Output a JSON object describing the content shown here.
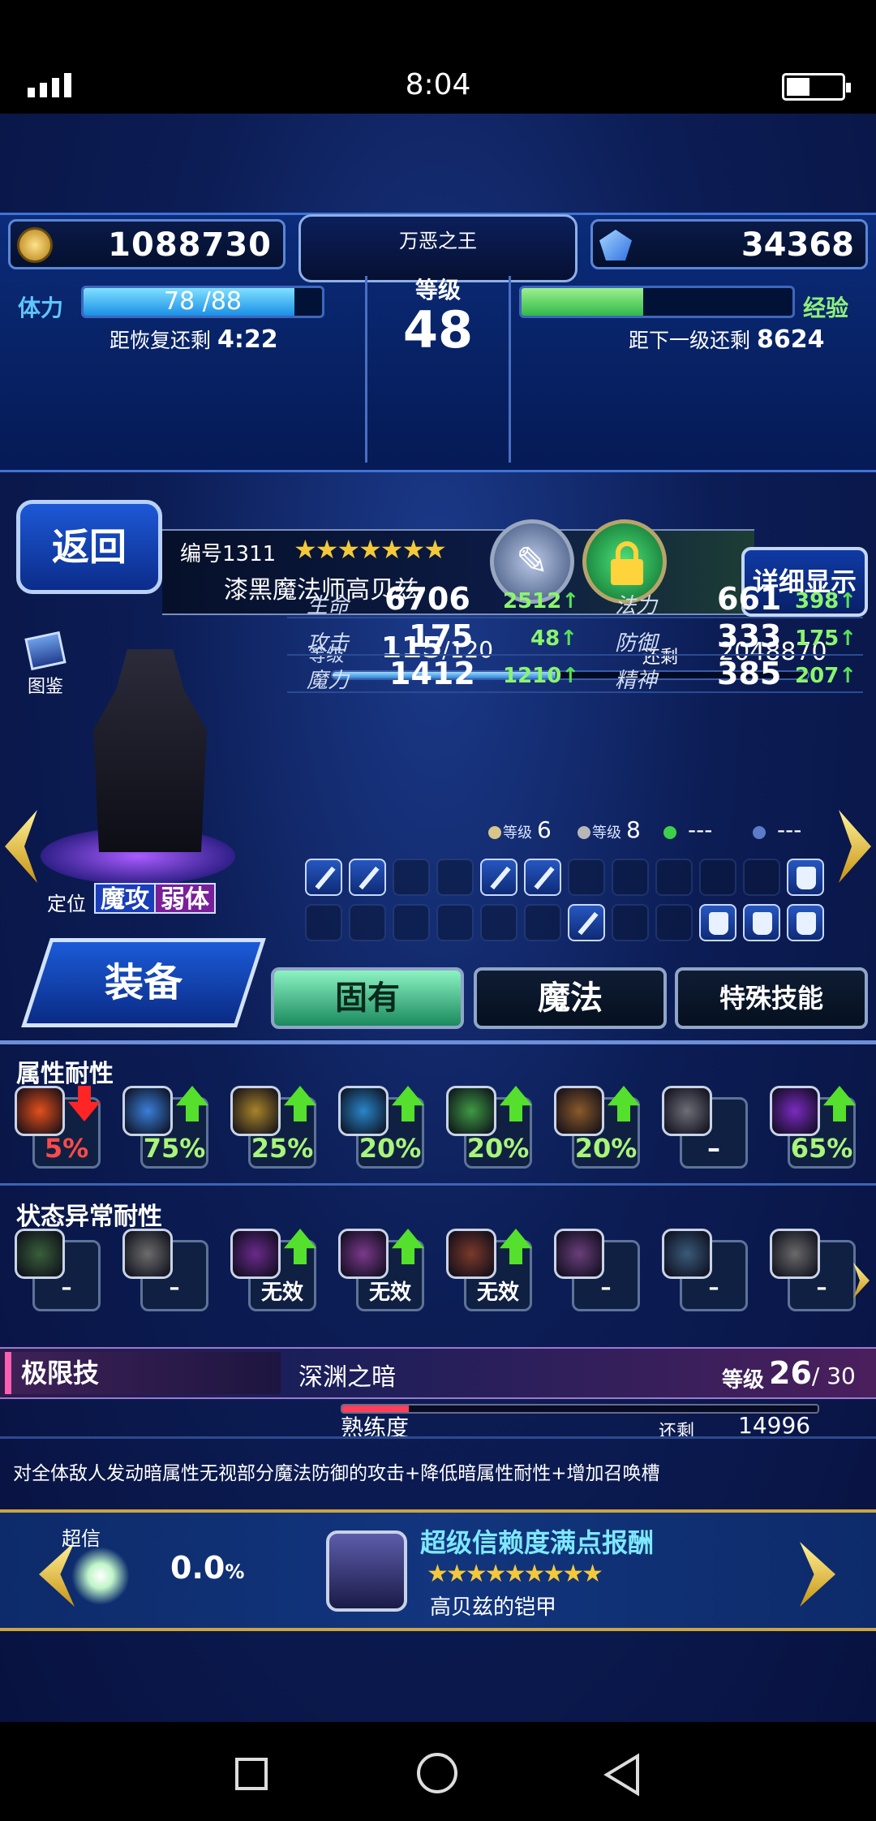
{
  "status_bar": {
    "time": "8:04"
  },
  "header": {
    "gil": "1088730",
    "gems": "34368",
    "title_name": "万恶之王",
    "level_label": "等级",
    "level": "48",
    "stamina_label": "体力",
    "stamina": "78 /88",
    "stamina_fraction": 0.886,
    "recover_label": "距恢复还剩",
    "recover_time": "4:22",
    "exp_label": "经验",
    "exp_fraction": 0.45,
    "next_label": "距下一级还剩",
    "next_exp": "8624"
  },
  "unit": {
    "back_label": "返回",
    "number": "编号1311",
    "rarity_stars": "★★★★★★★",
    "name": "漆黑魔法师高贝兹",
    "detail_label": "详细显示",
    "encyclopedia_label": "图鉴",
    "role_label": "定位",
    "roles": [
      "魔攻",
      "弱体"
    ],
    "level_label": "等级",
    "level": "115",
    "level_max": "/120",
    "remaining_label": "还剩",
    "remaining_exp": "2048870",
    "level_fraction": 0.47
  },
  "stats": [
    {
      "left_label": "生命",
      "left_value": "6706",
      "left_bonus": "2512",
      "right_label": "法力",
      "right_value": "661",
      "right_bonus": "398"
    },
    {
      "left_label": "攻击",
      "left_value": "175",
      "left_bonus": "48",
      "right_label": "防御",
      "right_value": "333",
      "right_bonus": "175"
    },
    {
      "left_label": "魔力",
      "left_value": "1412",
      "left_bonus": "1210",
      "right_label": "精神",
      "right_value": "385",
      "right_bonus": "207"
    }
  ],
  "orbs": [
    {
      "label": "等级",
      "value": "6",
      "color": "#d8c58a"
    },
    {
      "label": "等级",
      "value": "8",
      "color": "#b7b7b7"
    },
    {
      "label": "",
      "value": "---",
      "color": "#3fd04a"
    },
    {
      "label": "",
      "value": "---",
      "color": "#5b7cc8"
    }
  ],
  "tabs": {
    "equip": "装备",
    "innate": "固有",
    "magic": "魔法",
    "special": "特殊技能"
  },
  "resistance": {
    "element_title": "属性耐性",
    "elements": [
      {
        "name": "fire-icon",
        "value": "5%",
        "trend": "down",
        "color": "#e4501b"
      },
      {
        "name": "ice-icon",
        "value": "75%",
        "trend": "up",
        "color": "#3a7fd8"
      },
      {
        "name": "lightning-icon",
        "value": "25%",
        "trend": "up",
        "color": "#a8842a"
      },
      {
        "name": "water-icon",
        "value": "20%",
        "trend": "up",
        "color": "#2a86c8"
      },
      {
        "name": "wind-icon",
        "value": "20%",
        "trend": "up",
        "color": "#3f9a44"
      },
      {
        "name": "earth-icon",
        "value": "20%",
        "trend": "up",
        "color": "#8a5a2a"
      },
      {
        "name": "light-icon",
        "value": "–",
        "trend": "none",
        "color": "#6e6e78"
      },
      {
        "name": "dark-icon",
        "value": "65%",
        "trend": "up",
        "color": "#7b2bbf"
      }
    ],
    "status_title": "状态异常耐性",
    "statuses": [
      {
        "name": "poison-icon",
        "value": "–",
        "trend": "none",
        "color": "#3a5f3a"
      },
      {
        "name": "blind-icon",
        "value": "–",
        "trend": "none",
        "color": "#6d6d6d"
      },
      {
        "name": "sleep-icon",
        "value": "无效",
        "trend": "up",
        "color": "#6a2b8a"
      },
      {
        "name": "silence-icon",
        "value": "无效",
        "trend": "up",
        "color": "#7a3a8a"
      },
      {
        "name": "paralyze-icon",
        "value": "无效",
        "trend": "up",
        "color": "#7a3a2a"
      },
      {
        "name": "confuse-icon",
        "value": "–",
        "trend": "none",
        "color": "#6a3f7a"
      },
      {
        "name": "disease-icon",
        "value": "–",
        "trend": "none",
        "color": "#3a5a7a"
      },
      {
        "name": "petrify-icon",
        "value": "–",
        "trend": "none",
        "color": "#6a6a6a"
      }
    ]
  },
  "limit_burst": {
    "label": "极限技",
    "name": "深渊之暗",
    "level_label": "等级",
    "level": "26",
    "level_max": "/ 30",
    "proficiency_label": "熟练度",
    "proficiency_fraction": 0.14,
    "remaining_label": "还剩",
    "remaining": "14996",
    "description": "对全体敌人发动暗属性无视部分魔法防御的攻击+降低暗属性耐性+增加召唤槽"
  },
  "trust": {
    "label": "超信",
    "value": "0.0",
    "unit": "%",
    "reward_title": "超级信赖度满点报酬",
    "reward_stars": "★★★★★★★★★",
    "reward_name": "高贝兹的铠甲"
  }
}
